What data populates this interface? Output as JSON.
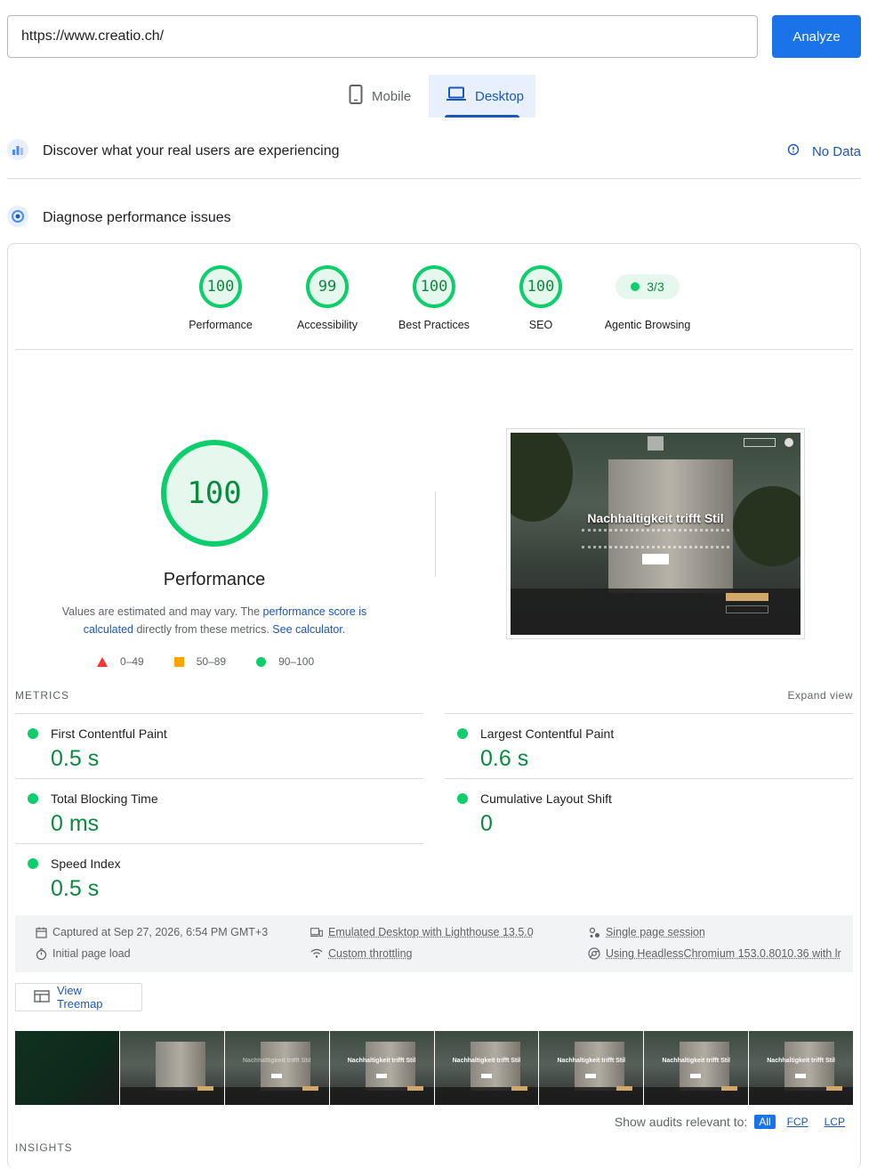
{
  "search": {
    "url": "https://www.creatio.ch/",
    "analyze_label": "Analyze"
  },
  "tabs": [
    {
      "label": "Mobile",
      "icon": "phone-icon",
      "active": false
    },
    {
      "label": "Desktop",
      "icon": "laptop-icon",
      "active": true
    }
  ],
  "real_users": {
    "title": "Discover what your real users are experiencing",
    "status": "No Data"
  },
  "diagnose": {
    "title": "Diagnose performance issues"
  },
  "scores": [
    {
      "label": "Performance",
      "value": "100"
    },
    {
      "label": "Accessibility",
      "value": "99"
    },
    {
      "label": "Best Practices",
      "value": "100"
    },
    {
      "label": "SEO",
      "value": "100"
    }
  ],
  "agentic": {
    "label": "Agentic Browsing",
    "value": "3/3"
  },
  "performance": {
    "score": "100",
    "title": "Performance",
    "desc_prefix": "Values are estimated and may vary. The ",
    "desc_link1": "performance score is calculated",
    "desc_middle": " directly from these metrics. ",
    "desc_link2": "See calculator",
    "desc_suffix": "."
  },
  "legend": {
    "fail": "0–49",
    "average": "50–89",
    "pass": "90–100"
  },
  "screenshot": {
    "headline": "Nachhaltigkeit trifft Stil"
  },
  "metrics": {
    "header": "METRICS",
    "expand": "Expand view",
    "fcp": {
      "label": "First Contentful Paint",
      "value": "0.5 s"
    },
    "lcp": {
      "label": "Largest Contentful Paint",
      "value": "0.6 s"
    },
    "tbt": {
      "label": "Total Blocking Time",
      "value": "0 ms"
    },
    "cls": {
      "label": "Cumulative Layout Shift",
      "value": "0"
    },
    "si": {
      "label": "Speed Index",
      "value": "0.5 s"
    }
  },
  "info": {
    "captured": "Captured at Sep 27, 2026, 6:54 PM GMT+3",
    "load": "Initial page load",
    "emulated": "Emulated Desktop with Lighthouse 13.5.0",
    "throttling": "Custom throttling",
    "session": "Single page session",
    "browser": "Using HeadlessChromium 153.0.8010.36 with lr"
  },
  "treemap_label": "View Treemap",
  "filmstrip_text": "Nachhaltigkeit trifft Stil",
  "audits": {
    "label": "Show audits relevant to:",
    "all": "All",
    "fcp": "FCP",
    "lcp": "LCP"
  },
  "insights_header": "INSIGHTS",
  "colors": {
    "pass": "#0cce6b",
    "pass_text": "#0a8a3e",
    "accent": "#1a73e8",
    "link": "#1a57b8",
    "fail": "#ff3333",
    "average": "#ffa400"
  }
}
